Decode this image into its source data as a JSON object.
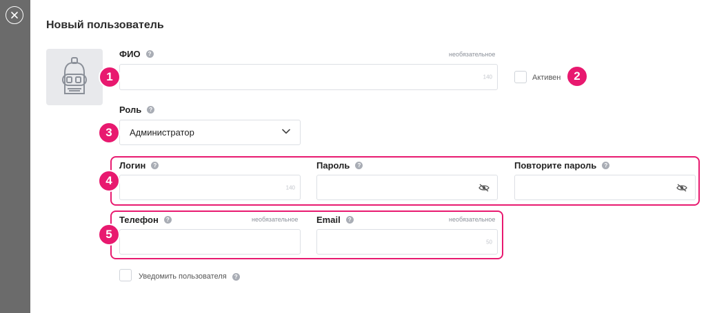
{
  "page": {
    "title": "Новый пользователь"
  },
  "fio": {
    "label": "ФИО",
    "optional": "необязательное",
    "counter": "140"
  },
  "active": {
    "label": "Активен"
  },
  "role": {
    "label": "Роль",
    "value": "Администратор"
  },
  "login": {
    "label": "Логин",
    "counter": "140"
  },
  "password": {
    "label": "Пароль"
  },
  "password_repeat": {
    "label": "Повторите пароль"
  },
  "phone": {
    "label": "Телефон",
    "optional": "необязательное"
  },
  "email": {
    "label": "Email",
    "optional": "необязательное",
    "counter": "50"
  },
  "notify": {
    "label": "Уведомить пользователя"
  },
  "help_glyph": "?",
  "badges": [
    "1",
    "2",
    "3",
    "4",
    "5"
  ],
  "icons": [
    "close-icon",
    "robot-avatar-icon",
    "help-icon",
    "chevron-down-icon",
    "eye-off-icon"
  ],
  "colors": {
    "accent": "#e8196f",
    "sidebar": "#6b6b6b",
    "avatar_bg": "#e8e9ec",
    "border": "#dcdfe4"
  }
}
